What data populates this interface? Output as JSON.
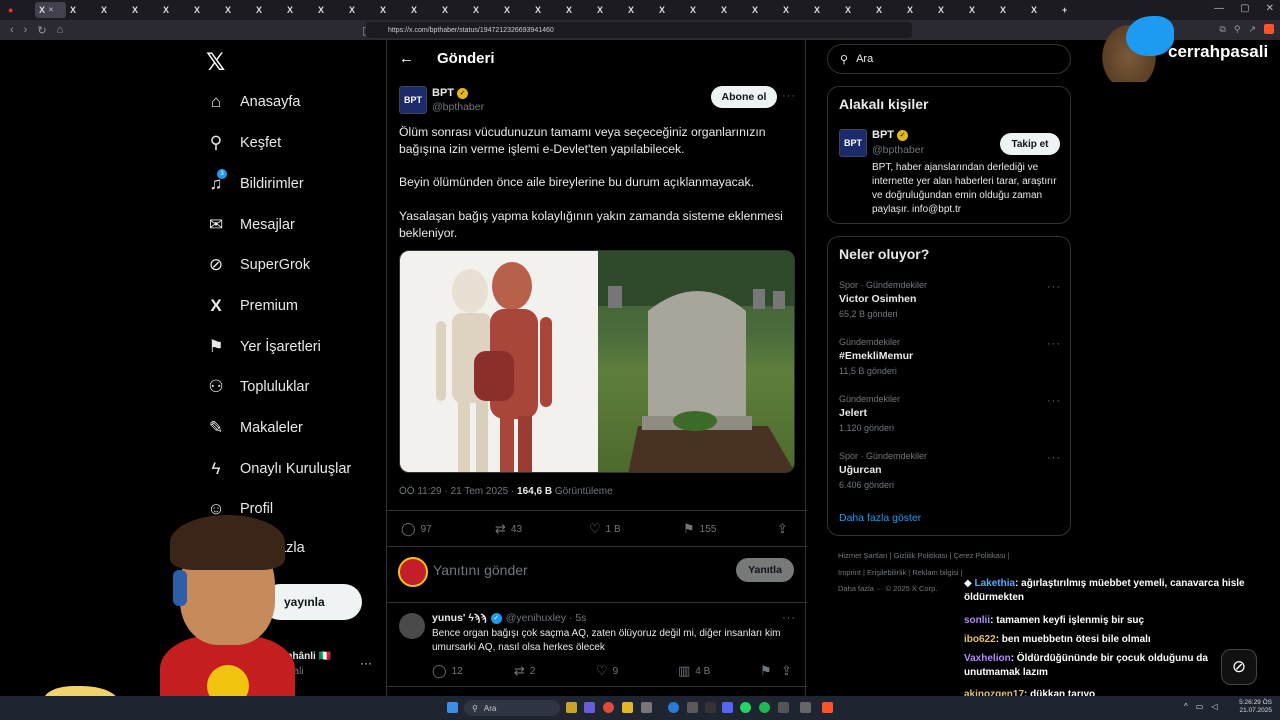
{
  "browser": {
    "url": "https://x.com/bpthaber/status/1947212326693941460",
    "tab_icon": "X"
  },
  "nav": {
    "items": [
      {
        "label": "Anasayfa",
        "icon": "home-icon",
        "glyph": "⌂"
      },
      {
        "label": "Keşfet",
        "icon": "search-icon",
        "glyph": "⚲"
      },
      {
        "label": "Bildirimler",
        "icon": "bell-icon",
        "glyph": "♫"
      },
      {
        "label": "Mesajlar",
        "icon": "mail-icon",
        "glyph": "✉"
      },
      {
        "label": "SuperGrok",
        "icon": "grok-icon",
        "glyph": "⊘"
      },
      {
        "label": "Premium",
        "icon": "x-premium-icon",
        "glyph": "X"
      },
      {
        "label": "Yer İşaretleri",
        "icon": "bookmark-icon",
        "glyph": "⚑"
      },
      {
        "label": "Topluluklar",
        "icon": "communities-icon",
        "glyph": "⚇"
      },
      {
        "label": "Makaleler",
        "icon": "articles-icon",
        "glyph": "✎"
      },
      {
        "label": "Onaylı Kuruluşlar",
        "icon": "lightning-icon",
        "glyph": "ϟ"
      },
      {
        "label": "Profil",
        "icon": "profile-icon",
        "glyph": "⚲"
      },
      {
        "label": "fazla",
        "icon": "more-icon",
        "glyph": ""
      }
    ],
    "notification_badge": "3",
    "post_button": "yayınla",
    "account_name": "rahânli 🇮🇹",
    "account_handle": "asali"
  },
  "header": {
    "title": "Gönderi"
  },
  "tweet": {
    "author": "BPT",
    "handle": "@bpthaber",
    "logo_text": "BPT",
    "subscribe_label": "Abone ol",
    "paragraphs": [
      "Ölüm sonrası vücudunuzun tamamı veya seçeceğiniz organlarınızın bağışına izin verme işlemi e-Devlet'ten yapılabilecek.",
      "Beyin ölümünden önce aile bireylerine bu durum açıklanmayacak.",
      "Yasalaşan bağış yapma kolaylığının yakın zamanda sisteme eklenmesi bekleniyor."
    ],
    "time": "ÖÖ 11:29 · 21 Tem 2025 · ",
    "views": "164,6 B",
    "views_label": " Görüntüleme",
    "stats": {
      "replies": "97",
      "retweets": "43",
      "likes": "1 B",
      "bookmarks": "155"
    }
  },
  "reply_box": {
    "placeholder": "Yanıtını gönder",
    "button": "Yanıtla"
  },
  "reply": {
    "name": "yunus' ϟϡϡ",
    "handle": "@yenihuxley · 5s",
    "text": "Bence organ bağışı çok saçma AQ, zaten ölüyoruz değil mi, diğer insanları kim umursarki AQ, nasıl olsa herkes ölecek",
    "stats": {
      "replies": "12",
      "retweets": "2",
      "likes": "9",
      "views": "4 B"
    }
  },
  "right": {
    "search_placeholder": "Ara",
    "related": {
      "title": "Alakalı kişiler",
      "name": "BPT",
      "handle": "@bpthaber",
      "follow": "Takip et",
      "bio": "BPT, haber ajanslarından derlediği ve internette yer alan haberleri tarar, araştırır ve doğruluğundan emin olduğu zaman paylaşır. info@bpt.tr"
    },
    "trends": {
      "title": "Neler oluyor?",
      "items": [
        {
          "category": "Spor · Gündemdekiler",
          "name": "Victor Osimhen",
          "count": "65,2 B gönderi"
        },
        {
          "category": "Gündemdekiler",
          "name": "#EmekliMemur",
          "count": "11,5 B gönderi"
        },
        {
          "category": "Gündemdekiler",
          "name": "Jelert",
          "count": "1.120 gönderi"
        },
        {
          "category": "Spor · Gündemdekiler",
          "name": "Uğurcan",
          "count": "6.406 gönderi"
        }
      ],
      "show_more": "Daha fazla göster"
    },
    "footer": {
      "line1": "Hizmet Şartları  |  Gizlilik Politikası  |  Çerez Politikası  |",
      "line2": "Imprint  |  Erişilebilirlik  |  Reklam bilgisi  |",
      "line3": "Daha fazla ···  © 2025 X Corp."
    }
  },
  "overlay": {
    "brand": "cerrahpasali",
    "chat": [
      {
        "user": "Lakethia",
        "msg": ": ağırlaştırılmış müebbet yemeli, canavarca hisle öldürmekten",
        "color": "blue"
      },
      {
        "user": "sonlii",
        "msg": ": tamamen keyfi işlenmiş bir suç",
        "color": "purple"
      },
      {
        "user": "ibo622",
        "msg": ": ben muebbetın ötesi bile olmalı",
        "color": "yellow"
      },
      {
        "user": "Vaxhelion",
        "msg": ": Öldürdüğününde bir çocuk olduğunu da unutmamak lazım",
        "color": "purple"
      },
      {
        "user": "akinozgen17",
        "msg": ": dükkan tarıyo",
        "color": "yellow"
      }
    ]
  },
  "taskbar": {
    "search": "Ara",
    "time": "5:26:29 ÖS",
    "date": "21.07.2025"
  }
}
